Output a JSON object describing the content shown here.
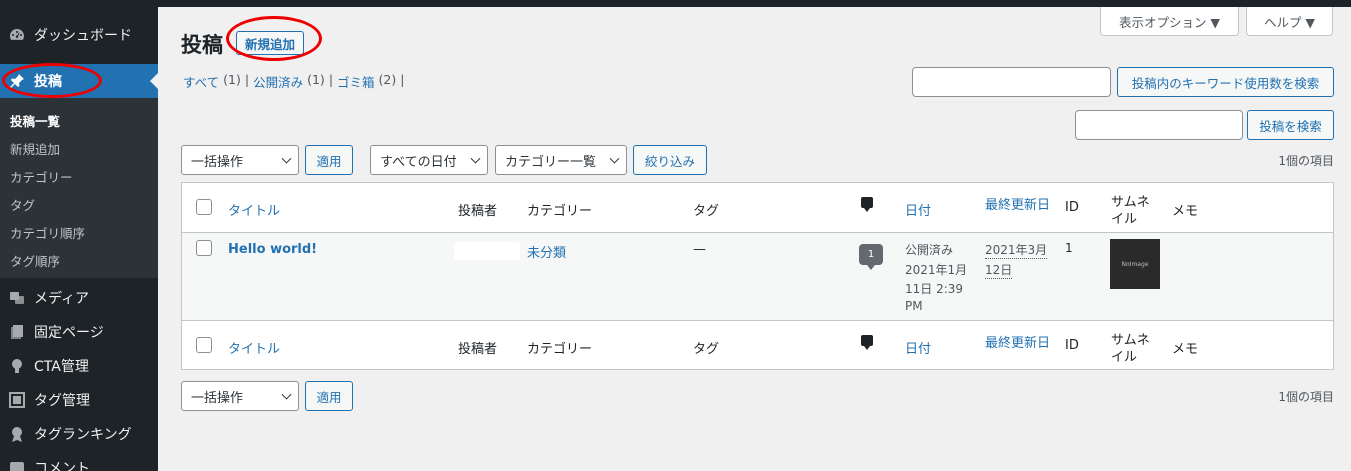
{
  "sidebar": {
    "dashboard": "ダッシュボード",
    "posts": "投稿",
    "submenu": [
      "投稿一覧",
      "新規追加",
      "カテゴリー",
      "タグ",
      "カテゴリ順序",
      "タグ順序"
    ],
    "media": "メディア",
    "pages": "固定ページ",
    "cta": "CTA管理",
    "tag_manage": "タグ管理",
    "tag_ranking": "タグランキング",
    "comments": "コメント"
  },
  "header": {
    "title": "投稿",
    "add_new": "新規追加",
    "screen_options": "表示オプション ▼",
    "help": "ヘルプ ▼"
  },
  "filters": {
    "all": "すべて",
    "all_count": "(1)",
    "published": "公開済み",
    "published_count": "(1)",
    "trash": "ゴミ箱",
    "trash_count": "(2)",
    "sep": "|"
  },
  "search": {
    "keyword_button": "投稿内のキーワード使用数を検索",
    "post_search_button": "投稿を検索",
    "keyword_value": "",
    "post_value": ""
  },
  "tablenav": {
    "bulk_action": "一括操作",
    "apply": "適用",
    "all_dates": "すべての日付",
    "categories": "カテゴリー一覧",
    "filter": "絞り込み",
    "items_count": "1個の項目"
  },
  "table": {
    "columns": {
      "title": "タイトル",
      "author": "投稿者",
      "categories": "カテゴリー",
      "tags": "タグ",
      "date": "日付",
      "modified": "最終更新日",
      "id": "ID",
      "thumbnail_1": "サムネ",
      "thumbnail_2": "イル",
      "memo": "メモ"
    },
    "rows": [
      {
        "title": "Hello world!",
        "category": "未分類",
        "tags": "—",
        "comments": "1",
        "date_status": "公開済み",
        "date_1": "2021年1月",
        "date_2": "11日 2:39",
        "date_3": "PM",
        "modified_1": "2021年3月",
        "modified_2": "12日",
        "id": "1",
        "thumb_text": "NoImage"
      }
    ]
  },
  "colors": {
    "accent": "#2271b1",
    "sidebar_bg": "#1d2327",
    "annotation": "#ee0000"
  }
}
